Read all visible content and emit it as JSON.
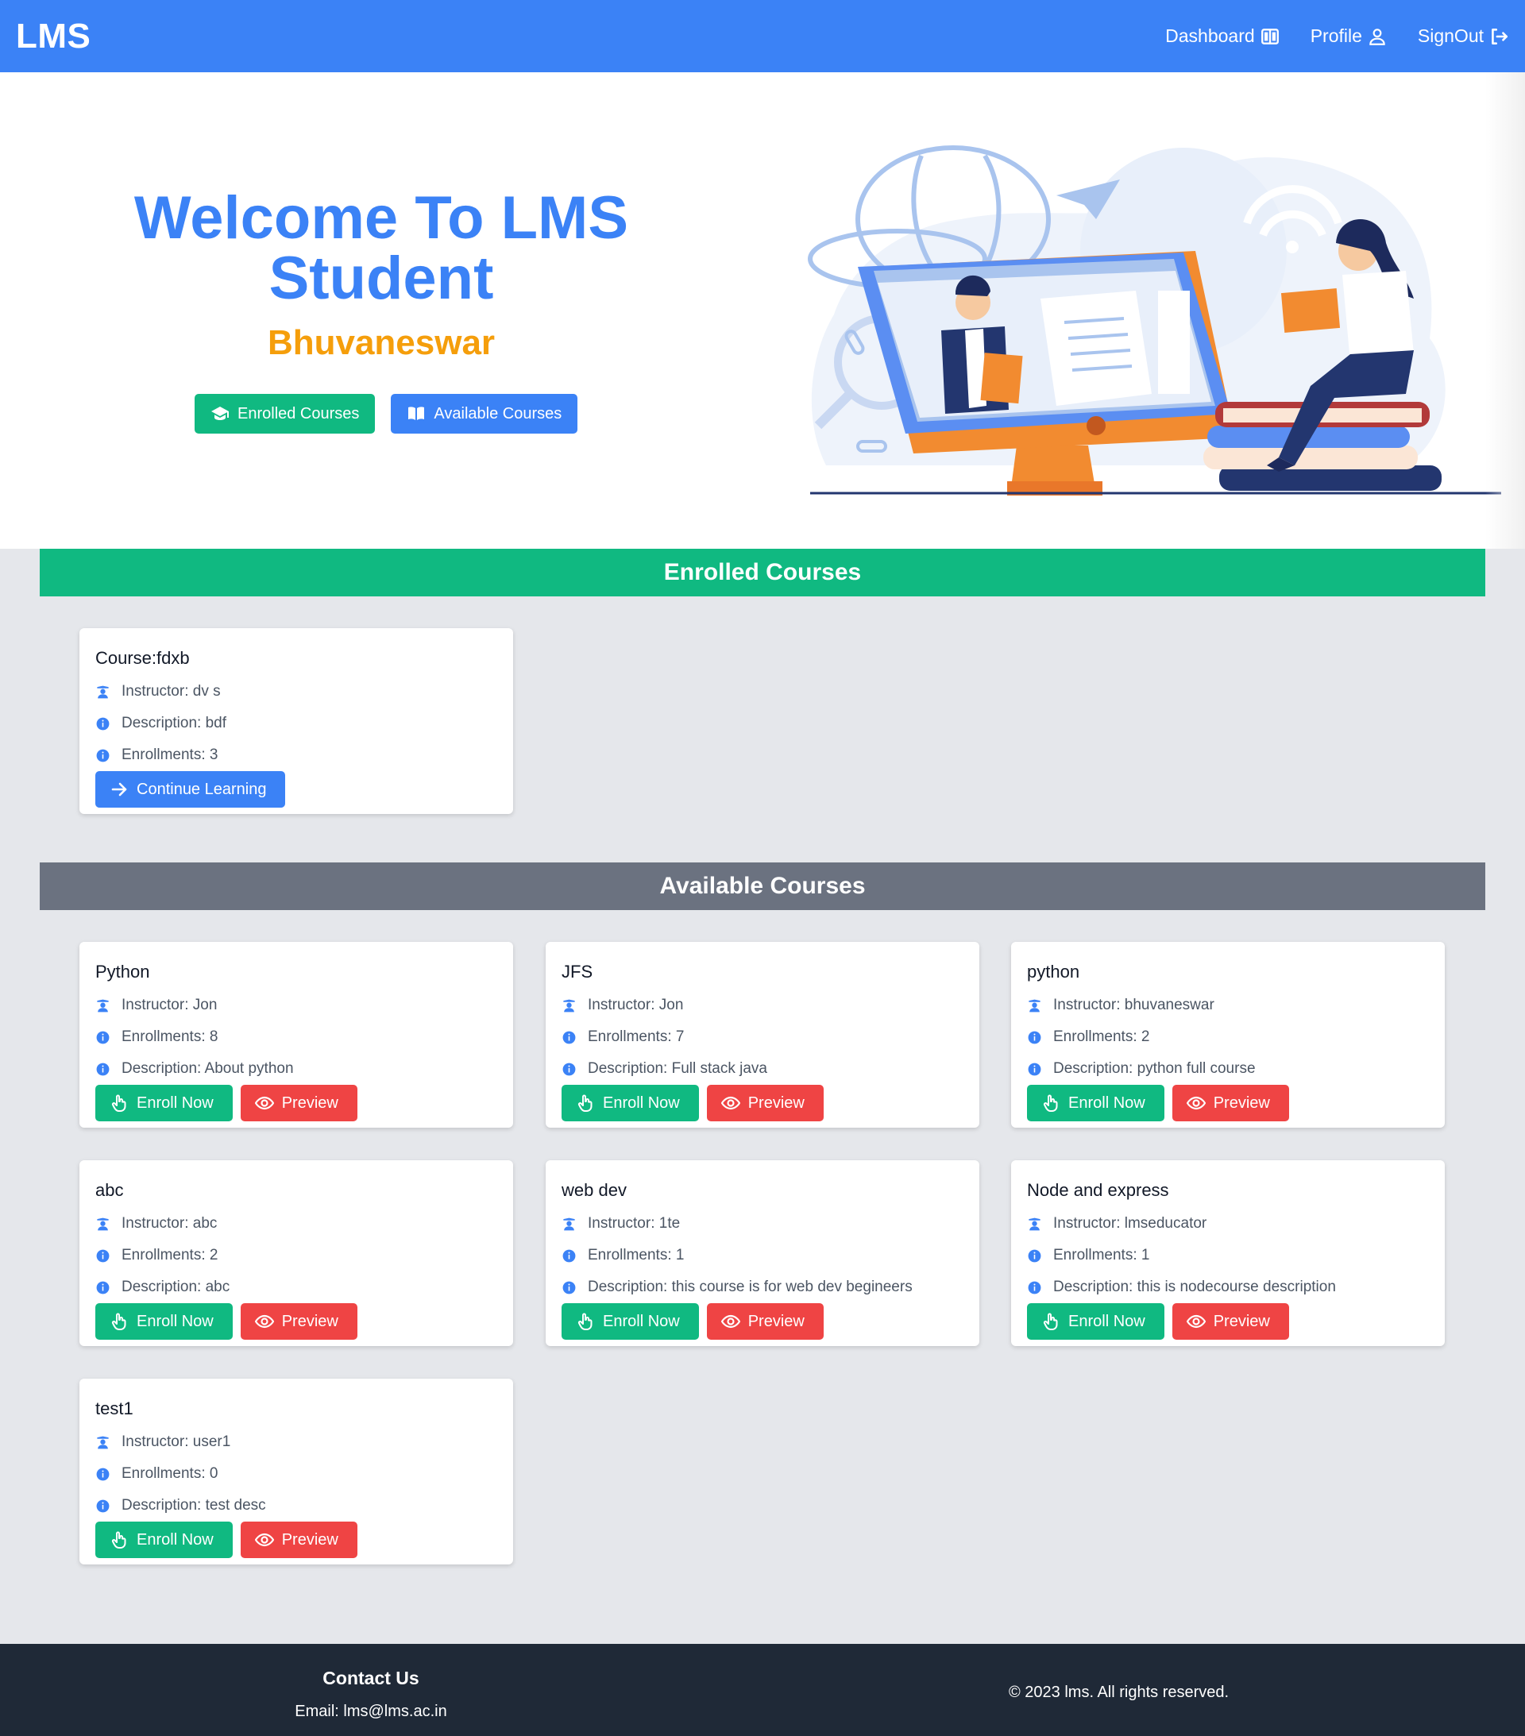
{
  "nav": {
    "brand": "LMS",
    "links": [
      "Dashboard",
      "Profile",
      "SignOut"
    ]
  },
  "hero": {
    "title_line1": "Welcome To LMS",
    "title_line2": "Student",
    "name": "Bhuvaneswar",
    "buttons": [
      "Enrolled Courses",
      "Available Courses"
    ]
  },
  "sections": {
    "enrolled": "Enrolled Courses",
    "available": "Available Courses"
  },
  "enrolled_courses": [
    {
      "title": "Course:fdxb",
      "instructor": "Instructor: dv s",
      "description": "Description: bdf",
      "enrollments": "Enrollments: 3",
      "action": "Continue Learning"
    }
  ],
  "available_courses": [
    {
      "title": "Python",
      "instructor": "Instructor: Jon",
      "enrollments": "Enrollments: 8",
      "description": "Description: About python",
      "enroll": "Enroll Now",
      "preview": "Preview"
    },
    {
      "title": "JFS",
      "instructor": "Instructor: Jon",
      "enrollments": "Enrollments: 7",
      "description": "Description: Full stack java",
      "enroll": "Enroll Now",
      "preview": "Preview"
    },
    {
      "title": "python",
      "instructor": "Instructor: bhuvaneswar",
      "enrollments": "Enrollments: 2",
      "description": "Description: python full course",
      "enroll": "Enroll Now",
      "preview": "Preview"
    },
    {
      "title": "abc",
      "instructor": "Instructor: abc",
      "enrollments": "Enrollments: 2",
      "description": "Description: abc",
      "enroll": "Enroll Now",
      "preview": "Preview"
    },
    {
      "title": "web dev",
      "instructor": "Instructor: 1te",
      "enrollments": "Enrollments: 1",
      "description": "Description: this course is for web dev begineers",
      "enroll": "Enroll Now",
      "preview": "Preview"
    },
    {
      "title": "Node and express",
      "instructor": "Instructor: lmseducator",
      "enrollments": "Enrollments: 1",
      "description": "Description: this is nodecourse description",
      "enroll": "Enroll Now",
      "preview": "Preview"
    },
    {
      "title": "test1",
      "instructor": "Instructor: user1",
      "enrollments": "Enrollments: 0",
      "description": "Description: test desc",
      "enroll": "Enroll Now",
      "preview": "Preview"
    }
  ],
  "footer": {
    "contact_title": "Contact Us",
    "email": "Email: lms@lms.ac.in",
    "copyright": "© 2023 lms. All rights reserved."
  },
  "colors": {
    "primary": "#3b82f6",
    "success": "#10b981",
    "danger": "#ef4444",
    "accent": "#f59e0b",
    "muted_bar": "#6b7280",
    "footer": "#1f2937"
  }
}
